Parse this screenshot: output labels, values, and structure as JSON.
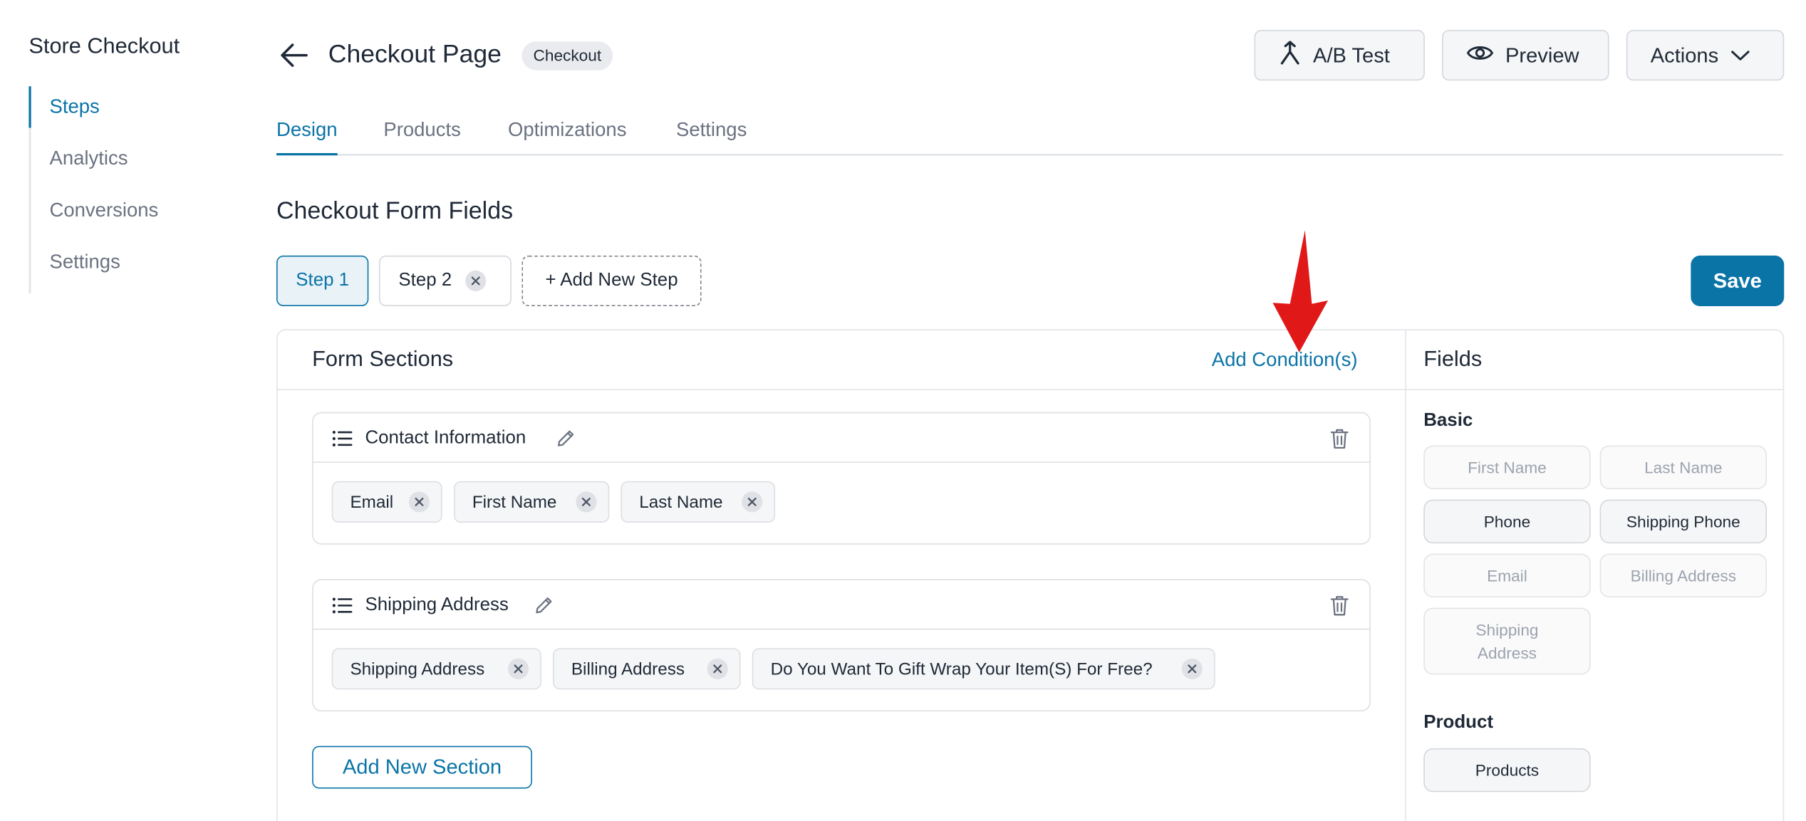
{
  "sidebar": {
    "title": "Store Checkout",
    "items": [
      {
        "label": "Steps",
        "active": true
      },
      {
        "label": "Analytics",
        "active": false
      },
      {
        "label": "Conversions",
        "active": false
      },
      {
        "label": "Settings",
        "active": false
      }
    ]
  },
  "header": {
    "title": "Checkout Page",
    "badge": "Checkout",
    "buttons": {
      "ab_test": "A/B Test",
      "preview": "Preview",
      "actions": "Actions"
    }
  },
  "tabs": [
    {
      "label": "Design",
      "active": true
    },
    {
      "label": "Products",
      "active": false
    },
    {
      "label": "Optimizations",
      "active": false
    },
    {
      "label": "Settings",
      "active": false
    }
  ],
  "form": {
    "title": "Checkout Form Fields",
    "steps": [
      {
        "label": "Step 1",
        "active": true
      },
      {
        "label": "Step 2",
        "active": false
      }
    ],
    "add_step_label": "+ Add New Step",
    "save_label": "Save"
  },
  "form_sections": {
    "title": "Form Sections",
    "add_condition_label": "Add Condition(s)",
    "sections": [
      {
        "title": "Contact Information",
        "fields": [
          "Email",
          "First Name",
          "Last Name"
        ]
      },
      {
        "title": "Shipping Address",
        "fields": [
          "Shipping Address",
          "Billing Address",
          "Do You Want To Gift Wrap Your Item(S) For Free?"
        ]
      }
    ],
    "add_section_label": "Add New Section"
  },
  "fields_panel": {
    "title": "Fields",
    "groups": {
      "basic": {
        "label": "Basic",
        "items": [
          {
            "label": "First Name",
            "enabled": false
          },
          {
            "label": "Last Name",
            "enabled": false
          },
          {
            "label": "Phone",
            "enabled": true
          },
          {
            "label": "Shipping Phone",
            "enabled": true
          },
          {
            "label": "Email",
            "enabled": false
          },
          {
            "label": "Billing Address",
            "enabled": false
          },
          {
            "label": "Shipping Address",
            "enabled": false
          }
        ]
      },
      "product": {
        "label": "Product",
        "items": [
          {
            "label": "Products",
            "enabled": true
          }
        ]
      }
    }
  },
  "colors": {
    "accent": "#0a74a7",
    "annotation_arrow": "#e01818"
  }
}
